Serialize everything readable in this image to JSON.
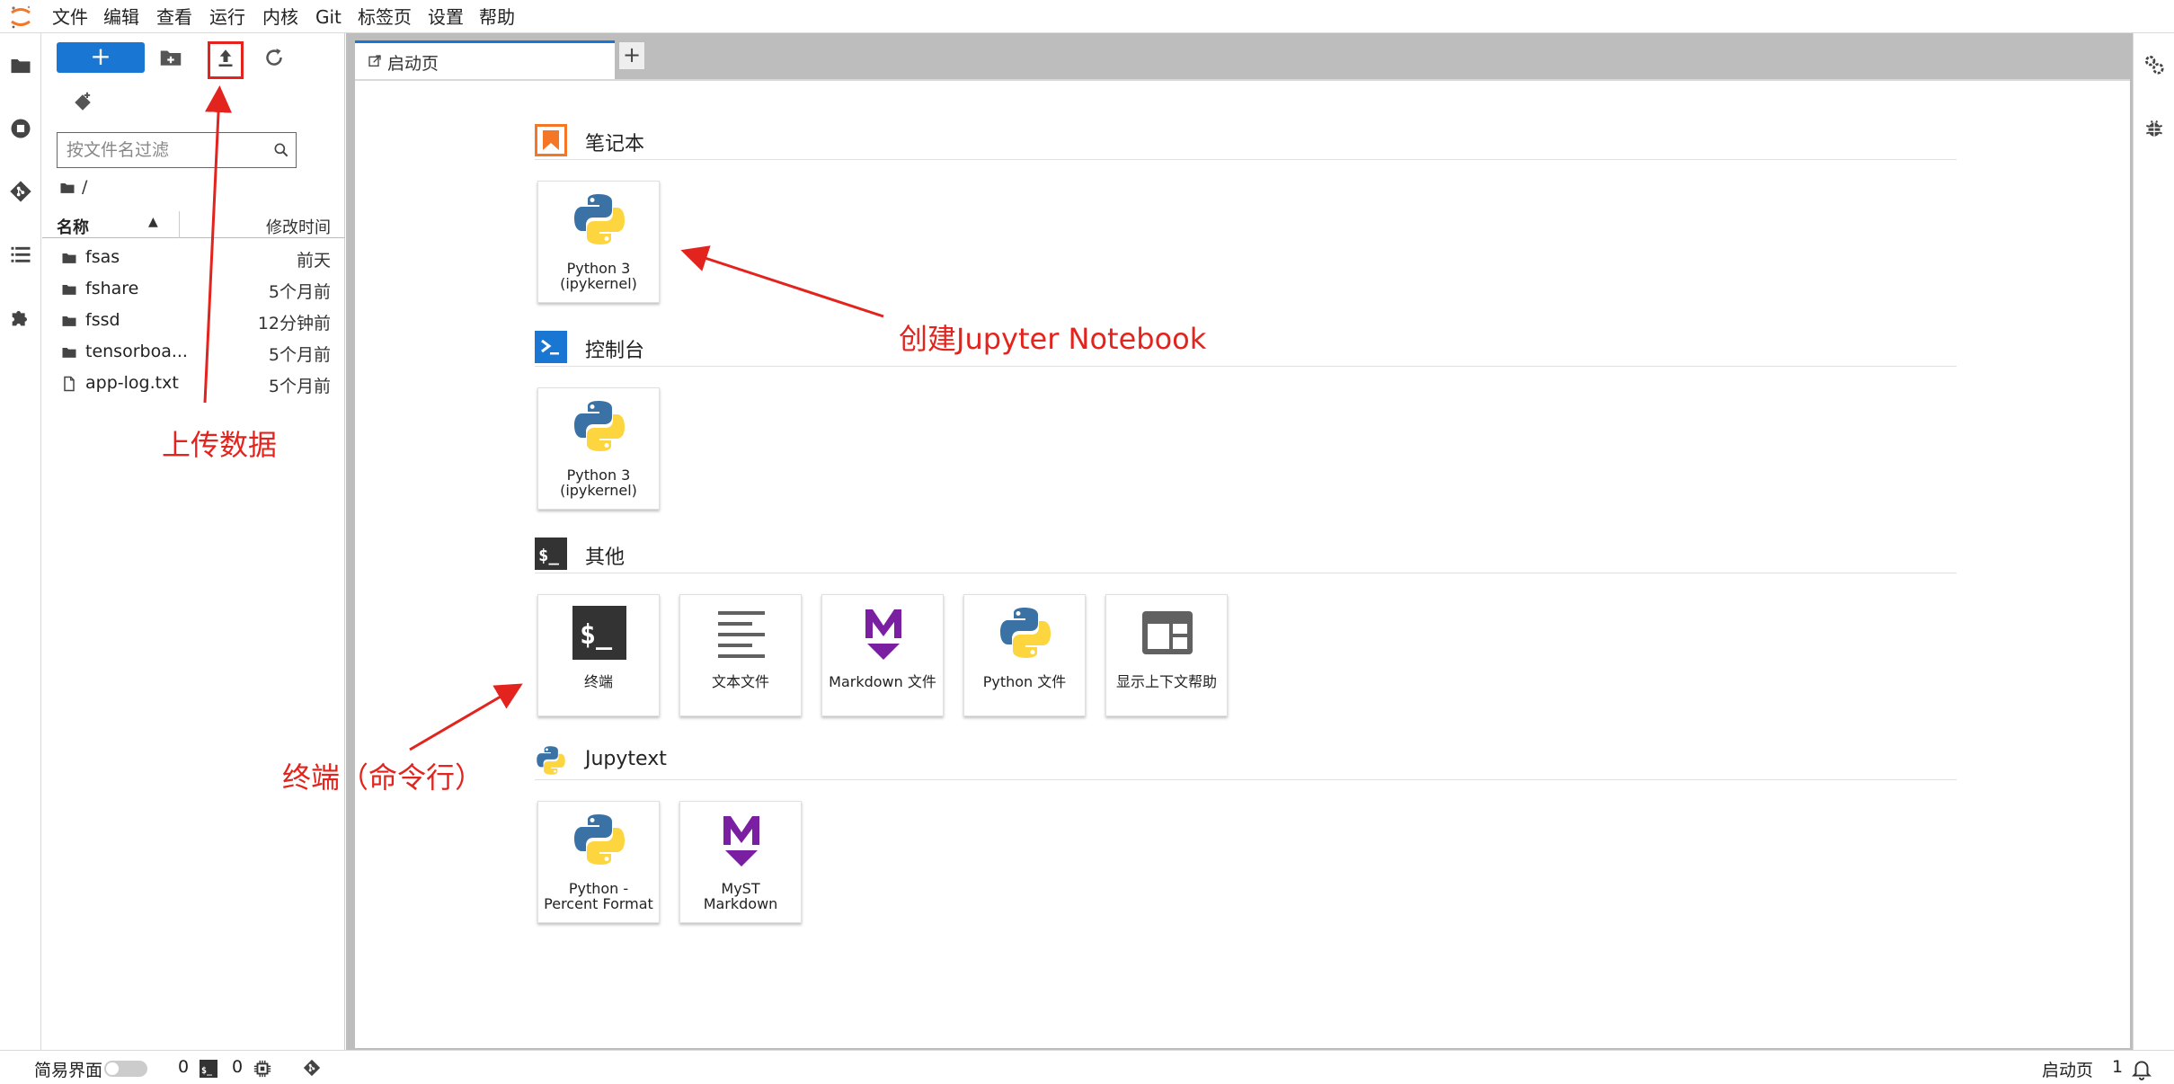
{
  "menubar": {
    "items": [
      "文件",
      "编辑",
      "查看",
      "运行",
      "内核",
      "Git",
      "标签页",
      "设置",
      "帮助"
    ]
  },
  "filebrowser": {
    "new_button_label": "+",
    "filter_placeholder": "按文件名过滤",
    "breadcrumb": "/",
    "columns": {
      "name": "名称",
      "modified": "修改时间"
    },
    "files": [
      {
        "name": "fsas",
        "type": "folder",
        "modified": "前天"
      },
      {
        "name": "fshare",
        "type": "folder",
        "modified": "5个月前"
      },
      {
        "name": "fssd",
        "type": "folder",
        "modified": "12分钟前"
      },
      {
        "name": "tensorboa...",
        "type": "folder",
        "modified": "5个月前"
      },
      {
        "name": "app-log.txt",
        "type": "file",
        "modified": "5个月前"
      }
    ]
  },
  "tabs": {
    "active_label": "启动页",
    "add_label": "+"
  },
  "launcher": {
    "sections": [
      {
        "title": "笔记本",
        "icon": "notebook-bookmark-icon",
        "cards": [
          {
            "label": "Python 3 (ipykernel)",
            "icon": "python-logo-icon"
          }
        ]
      },
      {
        "title": "控制台",
        "icon": "console-prompt-icon",
        "cards": [
          {
            "label": "Python 3 (ipykernel)",
            "icon": "python-logo-icon"
          }
        ]
      },
      {
        "title": "其他",
        "icon": "terminal-dollar-icon",
        "cards": [
          {
            "label": "终端",
            "icon": "terminal-icon"
          },
          {
            "label": "文本文件",
            "icon": "text-lines-icon"
          },
          {
            "label": "Markdown 文件",
            "icon": "markdown-m-icon"
          },
          {
            "label": "Python 文件",
            "icon": "python-logo-icon"
          },
          {
            "label": "显示上下文帮助",
            "icon": "context-help-icon"
          }
        ]
      },
      {
        "title": "Jupytext",
        "icon": "python-logo-icon",
        "cards": [
          {
            "label": "Python - Percent Format",
            "icon": "python-logo-icon"
          },
          {
            "label": "MyST Markdown",
            "icon": "markdown-m-icon"
          }
        ]
      }
    ]
  },
  "statusbar": {
    "simple_mode_label": "简易界面",
    "terminals_count": "0",
    "kernels_count": "0",
    "active_tab_label": "启动页",
    "notifications_count": "1"
  },
  "annotations": {
    "upload": "上传数据",
    "create_notebook": "创建Jupyter Notebook",
    "terminal": "终端（命令行）"
  },
  "colors": {
    "accent": "#1976d2",
    "annotation_red": "#e3231d",
    "notebook_orange": "#f37726",
    "markdown_purple": "#7b1fa2"
  }
}
